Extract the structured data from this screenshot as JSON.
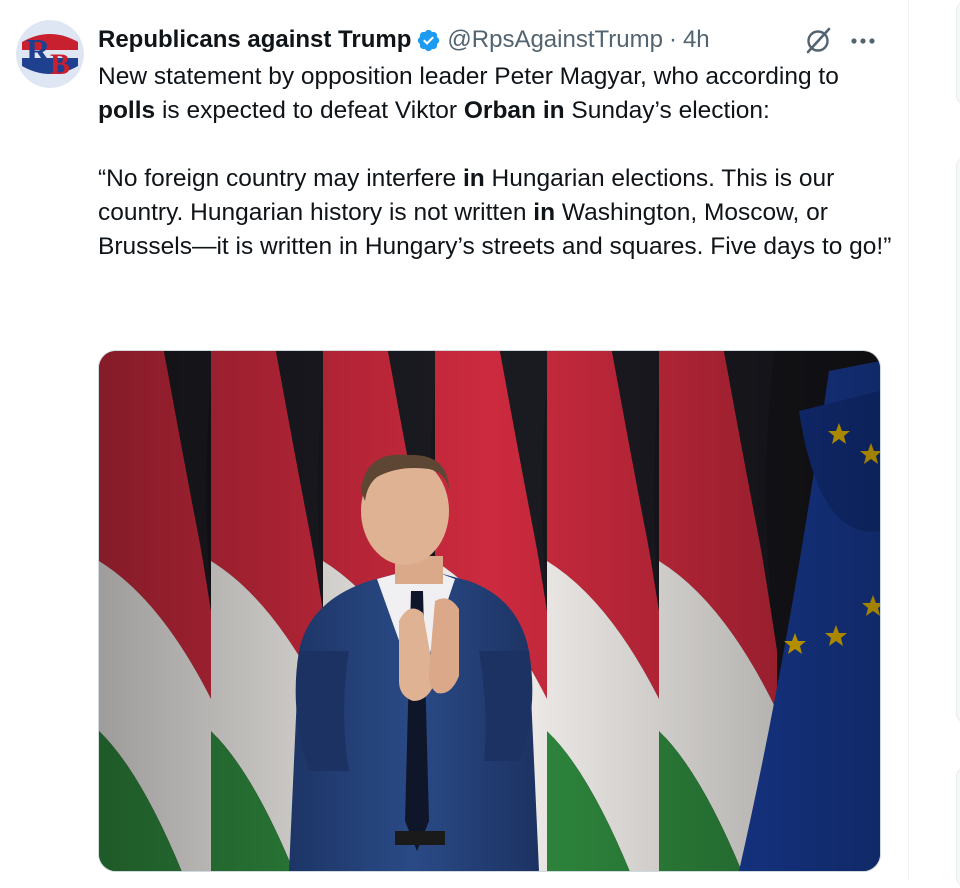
{
  "tweet": {
    "author_name": "Republicans against Trump",
    "handle": "@RpsAgainstTrump",
    "separator": "·",
    "time": "4h",
    "avatar_text": "RB",
    "avatar_letter_1": "R",
    "avatar_letter_2": "B",
    "verified_color": "#1d9bf0",
    "icons": {
      "verified": "verified-badge-icon",
      "grok": "grok-icon",
      "more": "more-options-icon"
    },
    "body": {
      "p1_a": "New statement by opposition leader Peter Magyar, who according to ",
      "p1_b": "polls",
      "p1_c": " is expected to defeat Viktor ",
      "p1_d": "Orban in",
      "p1_e": " Sunday’s election:",
      "p2_a": "“No foreign country may interfere ",
      "p2_b": "in",
      "p2_c": " Hungarian elections. This is our country. Hungarian history is not written ",
      "p2_d": "in",
      "p2_e": " Washington, Moscow, or Brussels—it is written in Hungary’s streets and squares. Five days to go!”"
    },
    "media": {
      "flag_colors": {
        "red": "#cd2a3e",
        "white": "#f4f1ee",
        "green": "#2f8a3e",
        "eu_blue": "#1a3fa0",
        "eu_star": "#f5c400"
      },
      "backdrop": "#17171c"
    }
  },
  "colors": {
    "text_primary": "#0f1419",
    "text_secondary": "#536471",
    "border": "#cfd9de"
  }
}
